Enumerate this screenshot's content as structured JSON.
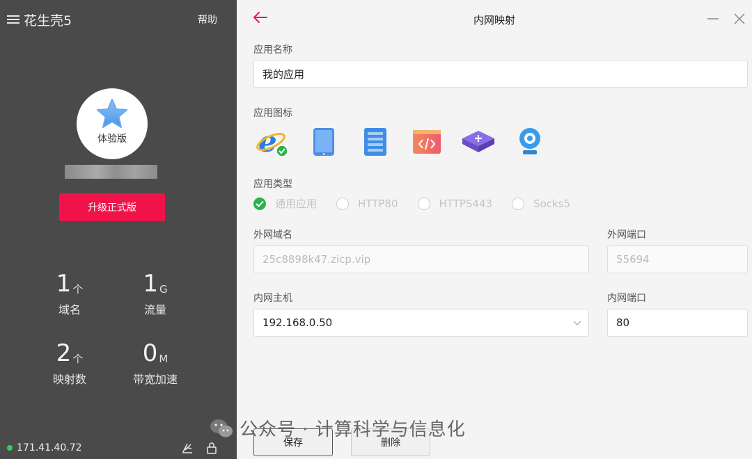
{
  "sidebar": {
    "app_title": "花生壳5",
    "help_label": "帮助",
    "avatar_label": "体验版",
    "upgrade_label": "升级正式版",
    "stats": [
      {
        "value": "1",
        "unit": "个",
        "label": "域名"
      },
      {
        "value": "1",
        "unit": "G",
        "label": "流量"
      },
      {
        "value": "2",
        "unit": "个",
        "label": "映射数"
      },
      {
        "value": "0",
        "unit": "M",
        "label": "带宽加速"
      }
    ],
    "ip_address": "171.41.40.72"
  },
  "panel": {
    "title": "内网映射",
    "app_name_label": "应用名称",
    "app_name_value": "我的应用",
    "app_icon_label": "应用图标",
    "app_icons": [
      "ie-browser-icon",
      "tablet-icon",
      "server-icon",
      "code-window-icon",
      "router-icon",
      "webcam-icon"
    ],
    "app_type_label": "应用类型",
    "app_types": [
      "通用应用",
      "HTTP80",
      "HTTPS443",
      "Socks5"
    ],
    "selected_type": "通用应用",
    "external_domain_label": "外网域名",
    "external_domain_value": "25c8898k47.zicp.vip",
    "external_port_label": "外网端口",
    "external_port_value": "55694",
    "internal_host_label": "内网主机",
    "internal_host_value": "192.168.0.50",
    "internal_port_label": "内网端口",
    "internal_port_value": "80",
    "save_label": "保存",
    "delete_label": "删除"
  },
  "watermark": {
    "text": "公众号 · 计算科学与信息化"
  },
  "colors": {
    "accent": "#f0134a",
    "sidebar_bg": "#4a4a4a",
    "online": "#2ed158",
    "check": "#2bb34a"
  }
}
